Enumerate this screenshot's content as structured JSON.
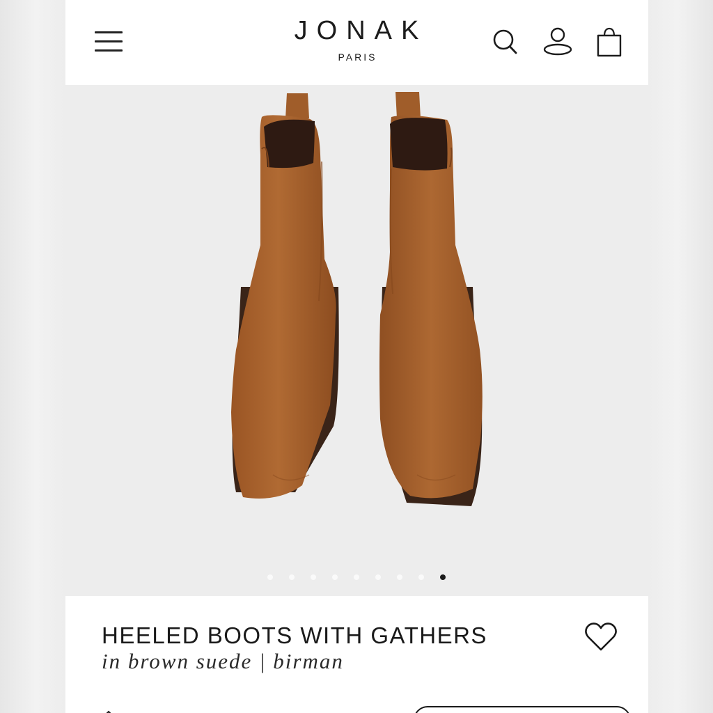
{
  "brand": {
    "name": "JONAK",
    "tagline": "PARIS"
  },
  "header": {
    "menu_icon": "hamburger-menu-icon",
    "search_icon": "search-icon",
    "account_icon": "user-icon",
    "bag_icon": "shopping-bag-icon"
  },
  "gallery": {
    "image_count": 9,
    "active_index": 8,
    "background": "#ededed"
  },
  "product": {
    "title": "HEELED BOOTS WITH GATHERS",
    "subtitle": "in brown suede | birman",
    "wishlist_icon": "heart-icon"
  },
  "colors": {
    "boot_suede": "#a35f2a",
    "sole": "#3a2418",
    "text": "#1a1a1a"
  }
}
